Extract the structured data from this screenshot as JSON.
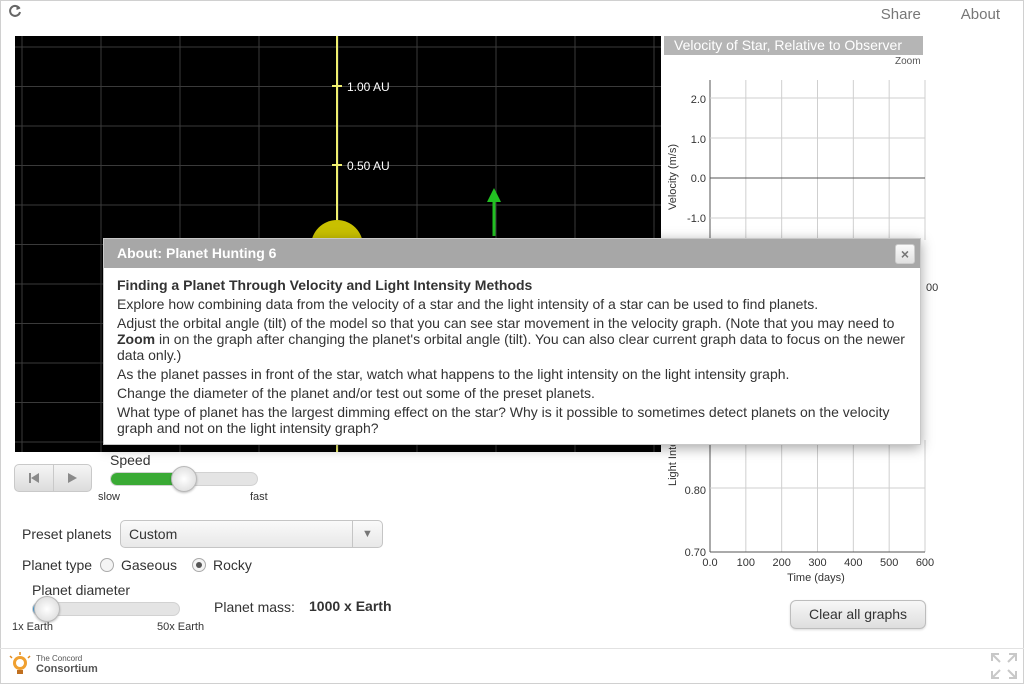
{
  "topnav": {
    "share": "Share",
    "about": "About"
  },
  "sim": {
    "ticks": [
      {
        "label": "1.00 AU"
      },
      {
        "label": "0.50 AU"
      }
    ]
  },
  "velocity_graph": {
    "title": "Velocity of Star, Relative to Observer",
    "zoom": "Zoom",
    "ylabel": "Velocity (m/s)",
    "yticks": [
      "2.0",
      "1.0",
      "0.0",
      "-1.0"
    ]
  },
  "light_graph": {
    "ylabel": "Light Inte",
    "yticks": [
      "0.80",
      "0.70"
    ],
    "xticks": [
      "0.0",
      "100",
      "200",
      "300",
      "400",
      "500",
      "600"
    ],
    "xlabel": "Time (days)",
    "partial_label": "00"
  },
  "chart_data": [
    {
      "type": "line",
      "title": "Velocity of Star, Relative to Observer",
      "ylabel": "Velocity (m/s)",
      "ylim": [
        -1.0,
        2.0
      ],
      "series": [
        {
          "x": [
            0,
            600
          ],
          "y": [
            0.0,
            0.0
          ]
        }
      ]
    },
    {
      "type": "line",
      "title": "",
      "xlabel": "Time (days)",
      "xlim": [
        0,
        600
      ],
      "ylim": [
        0.7,
        0.8
      ],
      "series": []
    }
  ],
  "controls": {
    "speed_label": "Speed",
    "speed_slow": "slow",
    "speed_fast": "fast",
    "speed_value": 0.5,
    "preset_label": "Preset planets",
    "preset_value": "Custom",
    "planet_type_label": "Planet type",
    "type_gaseous": "Gaseous",
    "type_rocky": "Rocky",
    "diameter_label": "Planet diameter",
    "diameter_min": "1x Earth",
    "diameter_max": "50x Earth",
    "diameter_value": 0.1,
    "mass_label": "Planet mass:",
    "mass_value": "1000 x Earth",
    "clear_button": "Clear all graphs"
  },
  "colors": {
    "speed_fill": "#3aaa35",
    "diameter_fill": "#4a9fd8",
    "planet_arrow": "#22c022",
    "star": "#c8c000",
    "axis": "#e8e870"
  },
  "footer": {
    "logo_line1": "The Concord",
    "logo_line2": "Consortium"
  },
  "dialog": {
    "title": "About: Planet Hunting 6",
    "close": "×",
    "heading": "Finding a Planet Through Velocity and Light Intensity Methods",
    "p1": "Explore how combining data from the velocity of a star and the light intensity of a star can be used to find planets.",
    "p2_a": "Adjust the orbital angle (tilt) of the model so that you can see star movement in the velocity graph. (Note that you may need to ",
    "p2_b": "Zoom",
    "p2_c": " in on the graph after changing the planet's orbital angle (tilt). You can also clear current graph data to focus on the newer data only.)",
    "p3": "As the planet passes in front of the star, watch what happens to the light intensity on the light intensity graph.",
    "p4": "Change the diameter of the planet and/or test out some of the preset planets.",
    "p5": "What type of planet has the largest dimming effect on the star? Why is it possible to sometimes detect planets on the velocity graph and not on the light intensity graph?"
  }
}
